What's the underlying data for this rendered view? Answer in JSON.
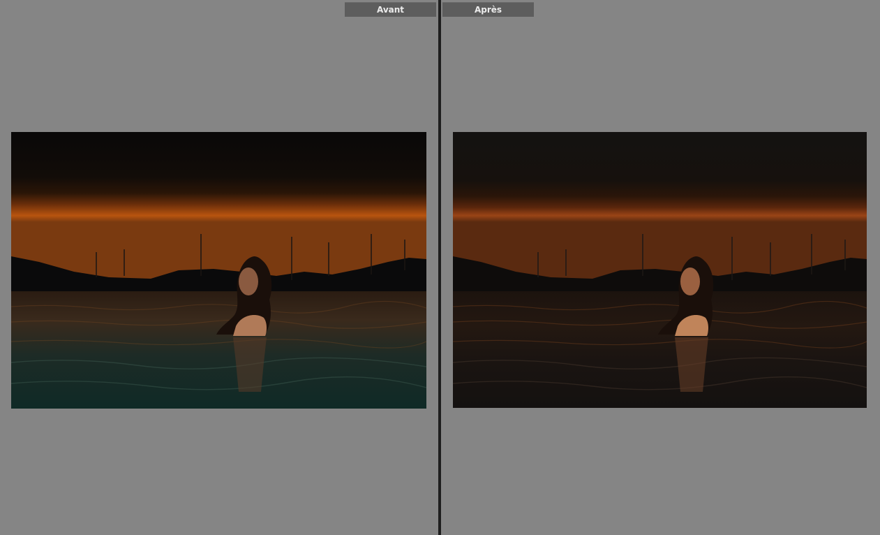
{
  "compare_view": {
    "before_label": "Avant",
    "after_label": "Après"
  },
  "colors": {
    "pane_background": "#858585",
    "divider": "#1e1e1e",
    "tab_background": "#5d5d5d",
    "tab_text": "#ececec"
  }
}
